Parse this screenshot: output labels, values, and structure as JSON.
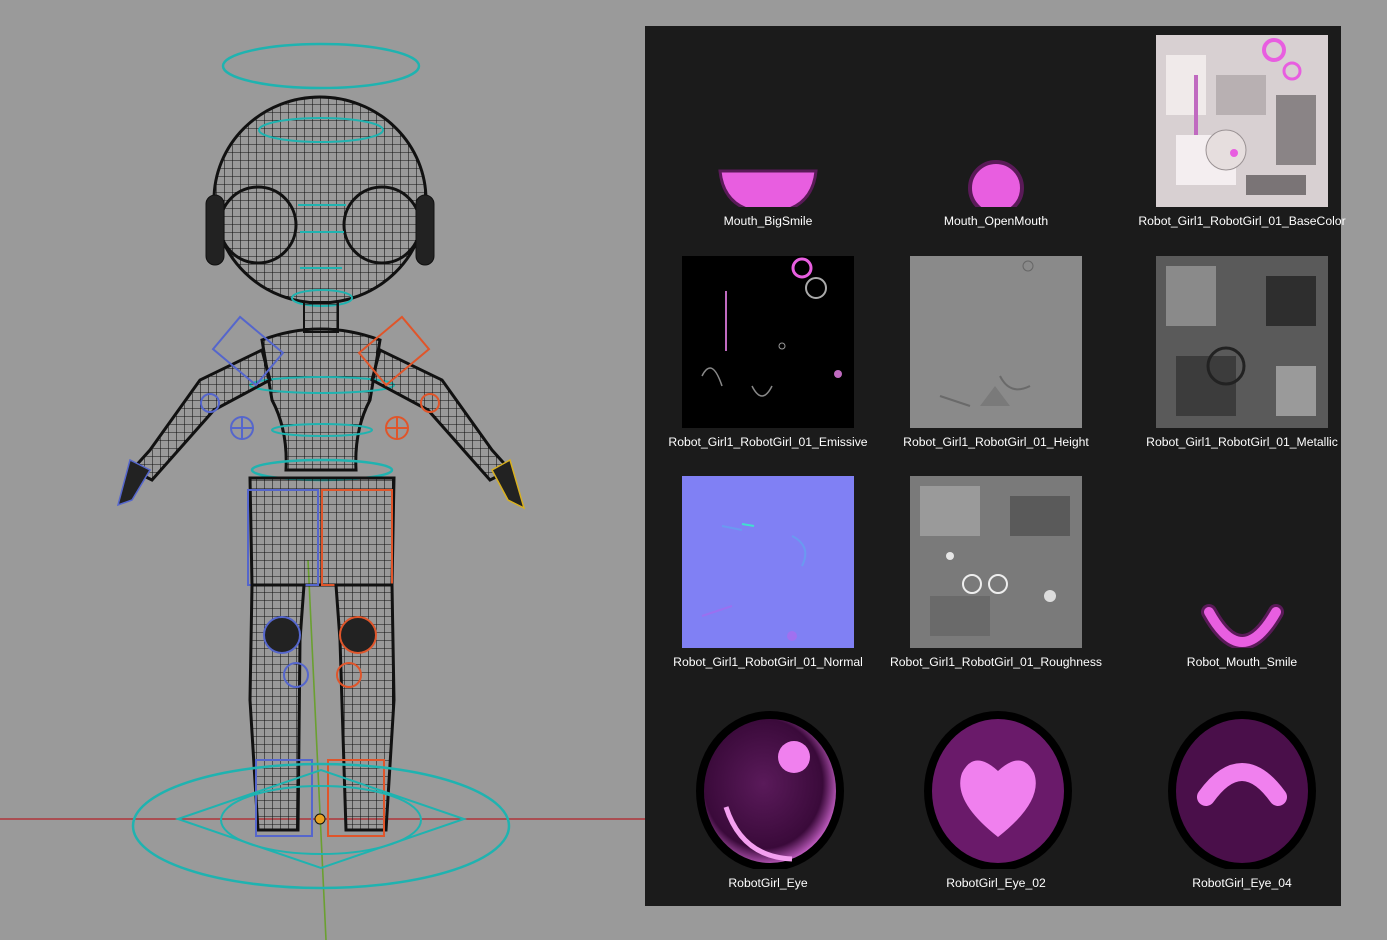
{
  "textures": [
    {
      "label": "Mouth_BigSmile",
      "icon": "mouth-bigsmile-thumbnail"
    },
    {
      "label": "Mouth_OpenMouth",
      "icon": "mouth-openmouth-thumbnail"
    },
    {
      "label": "Robot_Girl1_RobotGirl_01_BaseColor",
      "icon": "basecolor-texture-thumbnail"
    },
    {
      "label": "Robot_Girl1_RobotGirl_01_Emissive",
      "icon": "emissive-texture-thumbnail"
    },
    {
      "label": "Robot_Girl1_RobotGirl_01_Height",
      "icon": "height-texture-thumbnail"
    },
    {
      "label": "Robot_Girl1_RobotGirl_01_Metallic",
      "icon": "metallic-texture-thumbnail"
    },
    {
      "label": "Robot_Girl1_RobotGirl_01_Normal",
      "icon": "normal-texture-thumbnail"
    },
    {
      "label": "Robot_Girl1_RobotGirl_01_Roughness",
      "icon": "roughness-texture-thumbnail"
    },
    {
      "label": "Robot_Mouth_Smile",
      "icon": "mouth-smile-thumbnail"
    },
    {
      "label": "RobotGirl_Eye",
      "icon": "eye-thumbnail"
    },
    {
      "label": "RobotGirl_Eye_02",
      "icon": "eye-heart-thumbnail"
    },
    {
      "label": "RobotGirl_Eye_04",
      "icon": "eye-arc-thumbnail"
    }
  ],
  "colors": {
    "viewport_bg": "#9a9a9a",
    "browser_bg": "#1b1b1b",
    "accent_pink": "#e85ee0",
    "rig_teal": "#1fb3b0",
    "rig_left": "#5566cc",
    "rig_right": "#e0552a"
  }
}
